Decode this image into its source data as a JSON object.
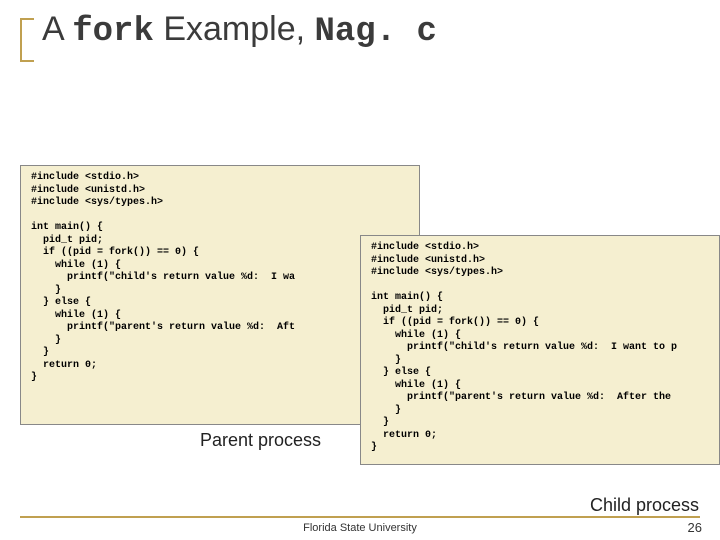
{
  "title": {
    "w1": "A ",
    "mono1": "fork",
    "w2": " Example, ",
    "mono2": "Nag. c"
  },
  "left_box": {
    "includes": "#include <stdio.h>\n#include <unistd.h>\n#include <sys/types.h>",
    "main": "int main() {\n  pid_t pid;\n  if ((pid = fork()) == 0) {\n    while (1) {\n      printf(\"child's return value %d:  I wa\n    }\n  } else {\n    while (1) {\n      printf(\"parent's return value %d:  Aft\n    }\n  }\n  return 0;\n}"
  },
  "right_box": {
    "includes": "#include <stdio.h>\n#include <unistd.h>\n#include <sys/types.h>",
    "main": "int main() {\n  pid_t pid;\n  if ((pid = fork()) == 0) {\n    while (1) {\n      printf(\"child's return value %d:  I want to p\n    }\n  } else {\n    while (1) {\n      printf(\"parent's return value %d:  After the\n    }\n  }\n  return 0;\n}"
  },
  "labels": {
    "left": "Parent process",
    "right": "Child process"
  },
  "footer": "Florida State University",
  "page": "26"
}
